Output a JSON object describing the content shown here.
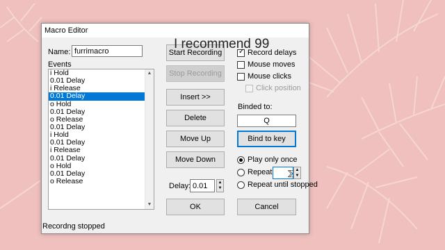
{
  "window": {
    "title": "Macro Editor"
  },
  "overlay_text": "I recommend 99",
  "name": {
    "label": "Name:",
    "value": "furrimacro"
  },
  "events": {
    "label": "Events",
    "items": [
      "i  Hold",
      "0.01  Delay",
      "i  Release",
      "0.01  Delay",
      "o  Hold",
      "0.01  Delay",
      "o  Release",
      "0.01  Delay",
      "i  Hold",
      "0.01  Delay",
      "i  Release",
      "0.01  Delay",
      "o  Hold",
      "0.01  Delay",
      "o  Release"
    ],
    "selected_index": 3
  },
  "buttons": {
    "start_recording": "Start Recording",
    "stop_recording": "Stop Recording",
    "insert": "Insert >>",
    "delete": "Delete",
    "move_up": "Move Up",
    "move_down": "Move Down",
    "ok": "OK",
    "cancel": "Cancel",
    "bind_to_key": "Bind to key"
  },
  "delay": {
    "label": "Delay:",
    "value": "0.01"
  },
  "options": {
    "record_delays": "Record delays",
    "mouse_moves": "Mouse moves",
    "mouse_clicks": "Mouse clicks",
    "click_position": "Click position"
  },
  "binding": {
    "label": "Binded to:",
    "key": "Q"
  },
  "repeat": {
    "play_once": "Play only once",
    "repeat": "Repeat",
    "repeat_until_stopped": "Repeat until stopped"
  },
  "status": "Recordng stopped",
  "colors": {
    "background": "#efc0bd",
    "selection": "#0078d7",
    "focus": "#0078d7"
  }
}
